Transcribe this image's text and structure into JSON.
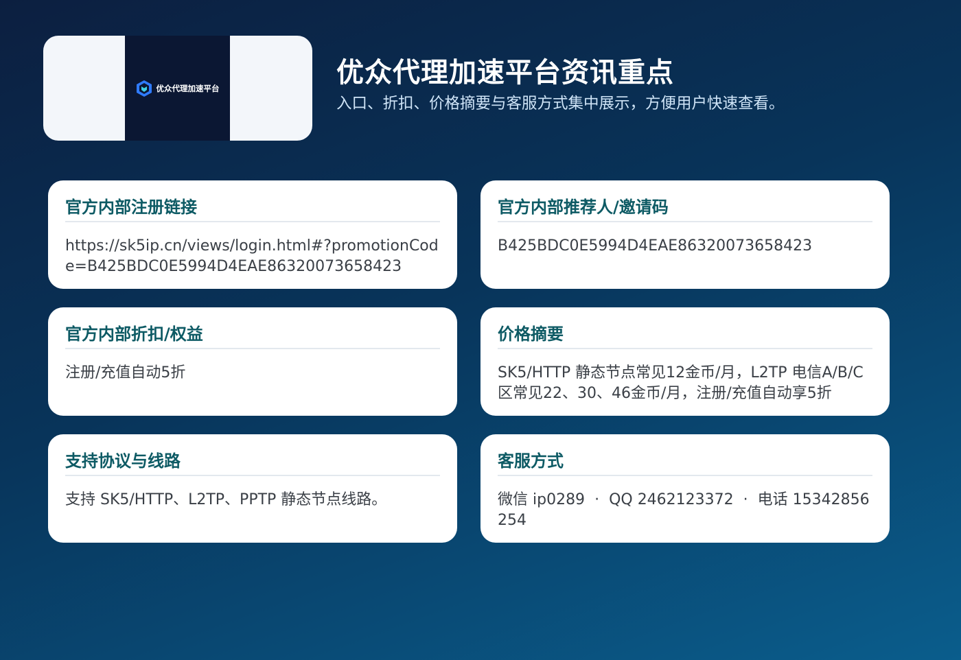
{
  "header": {
    "logo_text": "优众代理加速平台",
    "logo_icon": "hexagon-shield-icon",
    "title": "优众代理加速平台资讯重点",
    "subtitle": "入口、折扣、价格摘要与客服方式集中展示，方便用户快速查看。"
  },
  "cards": [
    {
      "title": "官方内部注册链接",
      "body": "https://sk5ip.cn/views/login.html#?promotionCode=B425BDC0E5994D4EAE86320073658423"
    },
    {
      "title": "官方内部推荐人/邀请码",
      "body": "B425BDC0E5994D4EAE86320073658423"
    },
    {
      "title": "官方内部折扣/权益",
      "body": "注册/充值自动5折"
    },
    {
      "title": "价格摘要",
      "body": "SK5/HTTP 静态节点常见12金币/月，L2TP 电信A/B/C区常见22、30、46金币/月，注册/充值自动享5折"
    },
    {
      "title": "支持协议与线路",
      "body": "支持 SK5/HTTP、L2TP、PPTP 静态节点线路。"
    },
    {
      "title": "客服方式",
      "wechat": "微信 ip0289",
      "qq": "QQ 2462123372",
      "phone": "电话 15342856254",
      "separator": "·"
    }
  ],
  "colors": {
    "card_title": "#0d5a64",
    "card_text": "#3a3f46",
    "background_top": "#0c1f40",
    "background_bottom": "#0a5d8c",
    "logo_dark": "#0b1733",
    "logo_accent": "#2f7bff"
  }
}
